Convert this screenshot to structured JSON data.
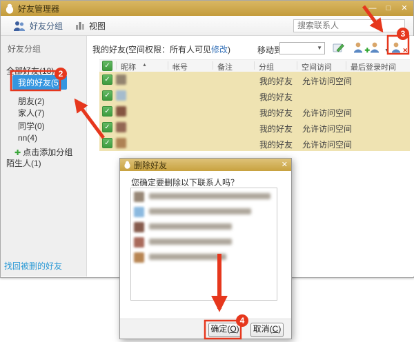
{
  "window": {
    "title": "好友管理器",
    "controls": {
      "minimize": "—",
      "maximize": "□",
      "close": "✕"
    }
  },
  "toolbar": {
    "groups": "好友分组",
    "view": "视图",
    "search_placeholder": "搜索联系人"
  },
  "sidebar": {
    "header": "好友分组",
    "items": [
      {
        "label": "全部好友(18)"
      },
      {
        "label": "我的好友(5)"
      },
      {
        "label": "朋友(2)"
      },
      {
        "label": "家人(7)"
      },
      {
        "label": "同学(0)"
      },
      {
        "label": "nn(4)"
      },
      {
        "label": "点击添加分组"
      },
      {
        "label": "陌生人(1)"
      }
    ],
    "recover_link": "找回被删的好友"
  },
  "content": {
    "header_prefix": "我的好友(空间权限：所有人可见",
    "modify_link": "修改",
    "header_suffix": ")",
    "move_to_label": "移动到"
  },
  "table": {
    "columns": [
      "昵称",
      "帐号",
      "备注",
      "分组",
      "空间访问",
      "最后登录时间"
    ],
    "rows": [
      {
        "group": "我的好友",
        "access": "允许访问空间"
      },
      {
        "group": "我的好友",
        "access": ""
      },
      {
        "group": "我的好友",
        "access": "允许访问空间"
      },
      {
        "group": "我的好友",
        "access": "允许访问空间"
      },
      {
        "group": "我的好友",
        "access": "允许访问空间"
      }
    ]
  },
  "dialog": {
    "title": "删除好友",
    "close": "✕",
    "message": "您确定要删除以下联系人吗？",
    "ok_prefix": "确定(",
    "ok_key": "O",
    "ok_suffix": ")",
    "cancel_prefix": "取消(",
    "cancel_key": "C",
    "cancel_suffix": ")"
  },
  "annotations": {
    "step2": "2",
    "step3": "3",
    "step4": "4"
  },
  "icons": {
    "dropdown": "▼",
    "sort_asc": "▲",
    "check": "✓",
    "plus": "✚",
    "cross": "✕"
  },
  "colors": {
    "titlebar_tan": "#cda94d",
    "selection_blue": "#3596e0",
    "row_highlight": "#efe3b2",
    "annotation_red": "#e6371d",
    "checkbox_green": "#4a9e4a",
    "link_blue": "#2e9bd6"
  }
}
